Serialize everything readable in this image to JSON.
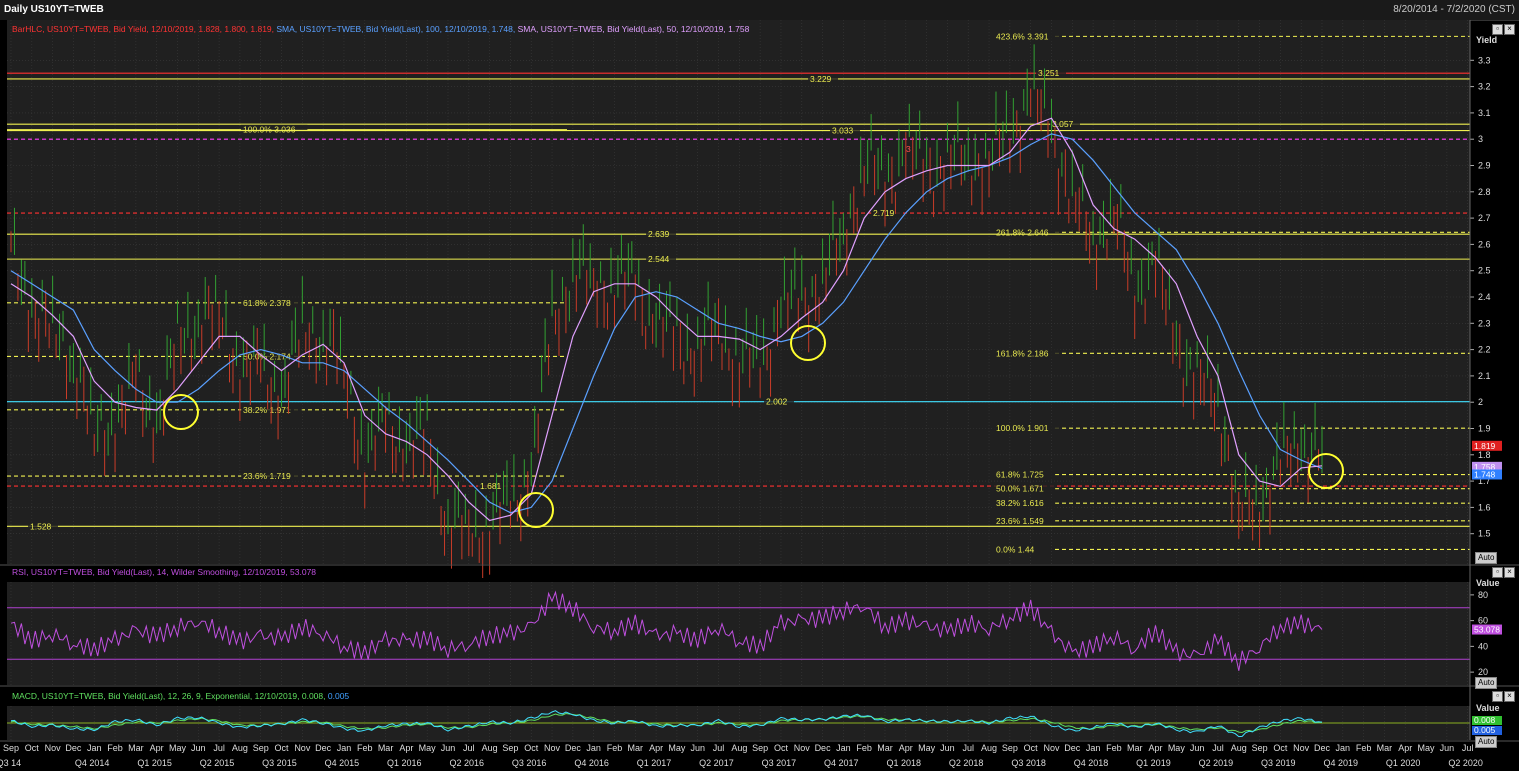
{
  "window": {
    "title": "Daily US10YT=TWEB",
    "range": "8/20/2014 - 7/2/2020 (CST)"
  },
  "panels": {
    "main": {
      "axis_title": "Yield",
      "auto_label": "Auto",
      "legend": [
        {
          "text": "BarHLC, US10YT=TWEB, Bid Yield, 12/10/2019, 1.828, 1.800, 1.819,",
          "color": "#ff3333"
        },
        {
          "text": "SMA, US10YT=TWEB, Bid Yield(Last), 100, 12/10/2019, 1.748,",
          "color": "#5aa0ff"
        },
        {
          "text": "SMA, US10YT=TWEB, Bid Yield(Last), 50, 12/10/2019, 1.758",
          "color": "#e0a0ff"
        }
      ]
    },
    "rsi": {
      "header": "RSI, US10YT=TWEB, Bid Yield(Last), 14, Wilder Smoothing, 12/10/2019, 53.078",
      "axis_title": "Value",
      "auto_label": "Auto",
      "last_label": "53.078"
    },
    "macd": {
      "header_main": "MACD, US10YT=TWEB, Bid Yield(Last), 12, 26, 9, Exponential, 12/10/2019, 0.008,",
      "header_signal": "0.005",
      "axis_title": "Value",
      "auto_label": "Auto",
      "last_macd": "0.008",
      "last_signal": "0.005"
    }
  },
  "colors": {
    "bg": "#000000",
    "plot_bg": "#202020",
    "grid": "#3a3a3a",
    "price": "#c83c28",
    "up": "#32a032",
    "sma100": "#5aa0ff",
    "sma50": "#e0a0ff",
    "yellow": "#f0f050",
    "red_dash": "#ff3030",
    "magenta_dash": "#ff40ff",
    "cyan": "#40e0ff",
    "rsi": "#c050e0",
    "macd": "#40e0ff",
    "signal": "#60e060"
  },
  "chart_data": [
    {
      "type": "line",
      "title": "Daily US10YT=TWEB",
      "ylabel": "Yield",
      "ylim": [
        1.4,
        3.4
      ],
      "y_ticks": [
        "3.3",
        "3.2",
        "3.1",
        "3",
        "2.9",
        "2.8",
        "2.7",
        "2.6",
        "2.5",
        "2.4",
        "2.3",
        "2.2",
        "2.1",
        "2",
        "1.9",
        "1.8",
        "1.7",
        "1.6",
        "1.5"
      ],
      "last_labels": [
        "1.819",
        "1.758",
        "1.748"
      ],
      "x_month_labels": [
        "Sep",
        "Oct",
        "Nov",
        "Dec",
        "Jan",
        "Feb",
        "Mar",
        "Apr",
        "May",
        "Jun",
        "Jul",
        "Aug",
        "Sep",
        "Oct",
        "Nov",
        "Dec",
        "Jan",
        "Feb",
        "Mar",
        "Apr",
        "May",
        "Jun",
        "Jul",
        "Aug",
        "Sep",
        "Oct",
        "Nov",
        "Dec",
        "Jan",
        "Feb",
        "Mar",
        "Apr",
        "May",
        "Jun",
        "Jul",
        "Aug",
        "Sep",
        "Oct",
        "Nov",
        "Dec",
        "Jan",
        "Feb",
        "Mar",
        "Apr",
        "May",
        "Jun",
        "Jul",
        "Aug",
        "Sep",
        "Oct",
        "Nov",
        "Dec",
        "Jan",
        "Feb",
        "Mar",
        "Apr",
        "May",
        "Jun",
        "Jul",
        "Aug",
        "Sep",
        "Oct",
        "Nov",
        "Dec",
        "Jan",
        "Feb",
        "Mar",
        "Apr",
        "May",
        "Jun",
        "Jul"
      ],
      "x_quarter_labels": [
        "Q3 14",
        "Q4 2014",
        "Q1 2015",
        "Q2 2015",
        "Q3 2015",
        "Q4 2015",
        "Q1 2016",
        "Q2 2016",
        "Q3 2016",
        "Q4 2016",
        "Q1 2017",
        "Q2 2017",
        "Q3 2017",
        "Q4 2017",
        "Q1 2018",
        "Q2 2018",
        "Q3 2018",
        "Q4 2018",
        "Q1 2019",
        "Q2 2019",
        "Q3 2019",
        "Q4 2019",
        "Q1 2020",
        "Q2 2020"
      ],
      "series": [
        {
          "name": "BarHLC",
          "kind": "ohlc",
          "dates": [
            "2014-09",
            "2014-10",
            "2014-11",
            "2014-12",
            "2015-01",
            "2015-02",
            "2015-03",
            "2015-04",
            "2015-05",
            "2015-06",
            "2015-07",
            "2015-08",
            "2015-09",
            "2015-10",
            "2015-11",
            "2015-12",
            "2016-01",
            "2016-02",
            "2016-03",
            "2016-04",
            "2016-05",
            "2016-06",
            "2016-07",
            "2016-08",
            "2016-09",
            "2016-10",
            "2016-11",
            "2016-12",
            "2017-01",
            "2017-02",
            "2017-03",
            "2017-04",
            "2017-05",
            "2017-06",
            "2017-07",
            "2017-08",
            "2017-09",
            "2017-10",
            "2017-11",
            "2017-12",
            "2018-01",
            "2018-02",
            "2018-03",
            "2018-04",
            "2018-05",
            "2018-06",
            "2018-07",
            "2018-08",
            "2018-09",
            "2018-10",
            "2018-11",
            "2018-12",
            "2019-01",
            "2019-02",
            "2019-03",
            "2019-04",
            "2019-05",
            "2019-06",
            "2019-07",
            "2019-08",
            "2019-09",
            "2019-10",
            "2019-11",
            "2019-12"
          ],
          "values": [
            2.55,
            2.38,
            2.25,
            2.2,
            1.85,
            1.95,
            2.05,
            1.95,
            2.2,
            2.35,
            2.3,
            2.15,
            2.1,
            2.05,
            2.25,
            2.28,
            2.1,
            1.8,
            1.9,
            1.85,
            1.85,
            1.55,
            1.5,
            1.55,
            1.6,
            1.75,
            2.3,
            2.5,
            2.45,
            2.45,
            2.45,
            2.3,
            2.25,
            2.2,
            2.3,
            2.15,
            2.15,
            2.35,
            2.4,
            2.45,
            2.65,
            2.9,
            2.85,
            2.95,
            2.9,
            2.9,
            2.95,
            2.9,
            3.05,
            3.15,
            3.05,
            2.75,
            2.65,
            2.7,
            2.45,
            2.5,
            2.25,
            2.05,
            2.05,
            1.55,
            1.65,
            1.75,
            1.85,
            1.82
          ]
        },
        {
          "name": "SMA 100",
          "values": [
            2.5,
            2.45,
            2.4,
            2.35,
            2.2,
            2.12,
            2.05,
            2.0,
            2.0,
            2.05,
            2.12,
            2.18,
            2.2,
            2.18,
            2.15,
            2.15,
            2.12,
            2.05,
            1.98,
            1.92,
            1.85,
            1.78,
            1.7,
            1.62,
            1.58,
            1.6,
            1.7,
            1.9,
            2.1,
            2.28,
            2.4,
            2.42,
            2.4,
            2.35,
            2.3,
            2.28,
            2.25,
            2.23,
            2.25,
            2.3,
            2.38,
            2.5,
            2.62,
            2.72,
            2.8,
            2.85,
            2.88,
            2.9,
            2.93,
            2.98,
            3.02,
            3.0,
            2.92,
            2.82,
            2.72,
            2.65,
            2.58,
            2.45,
            2.3,
            2.12,
            1.95,
            1.82,
            1.78,
            1.748
          ]
        },
        {
          "name": "SMA 50",
          "values": [
            2.45,
            2.4,
            2.33,
            2.25,
            2.08,
            2.0,
            1.98,
            1.97,
            2.05,
            2.15,
            2.25,
            2.25,
            2.18,
            2.12,
            2.18,
            2.22,
            2.15,
            1.95,
            1.88,
            1.85,
            1.8,
            1.72,
            1.62,
            1.55,
            1.57,
            1.65,
            1.95,
            2.25,
            2.42,
            2.45,
            2.45,
            2.4,
            2.32,
            2.25,
            2.25,
            2.24,
            2.2,
            2.25,
            2.32,
            2.38,
            2.5,
            2.7,
            2.8,
            2.85,
            2.88,
            2.9,
            2.9,
            2.9,
            2.95,
            3.05,
            3.08,
            2.95,
            2.75,
            2.66,
            2.62,
            2.55,
            2.45,
            2.25,
            2.1,
            1.8,
            1.7,
            1.68,
            1.75,
            1.758
          ]
        }
      ],
      "levels": [
        {
          "label": "423.6%",
          "value": 3.391,
          "text": "3.391"
        },
        {
          "label": "",
          "value": 3.251,
          "text": "3.251"
        },
        {
          "label": "",
          "value": 3.229,
          "text": "3.229"
        },
        {
          "label": "",
          "value": 3.057,
          "text": "3.057"
        },
        {
          "label": "100.0%",
          "value": 3.036,
          "text": "3.036"
        },
        {
          "label": "",
          "value": 3.033,
          "text": "3.033"
        },
        {
          "label": "",
          "value": 3.0,
          "text": ""
        },
        {
          "label": "",
          "value": 2.719,
          "text": "2.719"
        },
        {
          "label": "261.8%",
          "value": 2.646,
          "text": "2.646"
        },
        {
          "label": "",
          "value": 2.639,
          "text": "2.639"
        },
        {
          "label": "",
          "value": 2.544,
          "text": "2.544"
        },
        {
          "label": "61.8%",
          "value": 2.378,
          "text": "2.378"
        },
        {
          "label": "161.8%",
          "value": 2.186,
          "text": "2.186"
        },
        {
          "label": "50.0%",
          "value": 2.174,
          "text": "2.174"
        },
        {
          "label": "",
          "value": 2.002,
          "text": "2.002"
        },
        {
          "label": "38.2%",
          "value": 1.971,
          "text": "1.971"
        },
        {
          "label": "100.0%",
          "value": 1.901,
          "text": "1.901"
        },
        {
          "label": "61.8%",
          "value": 1.725,
          "text": "1.725"
        },
        {
          "label": "23.6%",
          "value": 1.719,
          "text": "1.719"
        },
        {
          "label": "",
          "value": 1.681,
          "text": "1.681"
        },
        {
          "label": "50.0%",
          "value": 1.671,
          "text": "1.671"
        },
        {
          "label": "38.2%",
          "value": 1.616,
          "text": "1.616"
        },
        {
          "label": "23.6%",
          "value": 1.549,
          "text": "1.549"
        },
        {
          "label": "",
          "value": 1.528,
          "text": "1.528"
        },
        {
          "label": "0.0%",
          "value": 1.44,
          "text": "1.44"
        }
      ],
      "annotation_text": [
        "3"
      ]
    },
    {
      "type": "line",
      "title": "RSI",
      "ylabel": "Value",
      "ylim": [
        10,
        90
      ],
      "y_ticks": [
        "80",
        "60",
        "40",
        "20"
      ],
      "bands": [
        70,
        30
      ],
      "series": [
        {
          "name": "RSI",
          "values": [
            58,
            44,
            50,
            42,
            38,
            45,
            52,
            48,
            55,
            60,
            52,
            44,
            48,
            46,
            55,
            50,
            40,
            35,
            45,
            44,
            46,
            38,
            42,
            48,
            50,
            55,
            78,
            70,
            55,
            52,
            58,
            48,
            50,
            45,
            55,
            44,
            40,
            58,
            60,
            62,
            68,
            72,
            55,
            60,
            55,
            52,
            58,
            54,
            62,
            70,
            50,
            35,
            40,
            48,
            38,
            52,
            35,
            32,
            45,
            28,
            40,
            55,
            58,
            53.078
          ]
        }
      ]
    },
    {
      "type": "line",
      "title": "MACD",
      "ylabel": "Value",
      "ylim": [
        -0.15,
        0.15
      ],
      "series": [
        {
          "name": "MACD",
          "values": [
            0.02,
            -0.03,
            -0.02,
            -0.05,
            -0.06,
            0.01,
            0.03,
            -0.02,
            0.04,
            0.05,
            0.0,
            -0.04,
            -0.02,
            -0.01,
            0.03,
            0.0,
            -0.05,
            -0.07,
            -0.02,
            -0.01,
            0.0,
            -0.06,
            -0.03,
            0.01,
            0.0,
            0.04,
            0.1,
            0.08,
            0.02,
            0.0,
            0.02,
            -0.03,
            -0.02,
            -0.02,
            0.02,
            -0.03,
            -0.02,
            0.04,
            0.03,
            0.03,
            0.06,
            0.07,
            0.01,
            0.03,
            0.02,
            0.01,
            0.02,
            0.0,
            0.04,
            0.06,
            -0.02,
            -0.07,
            -0.04,
            0.0,
            -0.04,
            0.0,
            -0.06,
            -0.08,
            -0.02,
            -0.12,
            -0.04,
            0.02,
            0.04,
            0.008
          ]
        },
        {
          "name": "Signal",
          "values": [
            0.01,
            -0.01,
            -0.02,
            -0.03,
            -0.05,
            -0.02,
            0.01,
            0.0,
            0.02,
            0.04,
            0.02,
            -0.02,
            -0.02,
            -0.01,
            0.01,
            0.01,
            -0.03,
            -0.05,
            -0.04,
            -0.02,
            -0.01,
            -0.04,
            -0.04,
            -0.01,
            0.0,
            0.02,
            0.07,
            0.08,
            0.04,
            0.01,
            0.01,
            -0.01,
            -0.02,
            -0.02,
            0.0,
            -0.01,
            -0.02,
            0.02,
            0.03,
            0.03,
            0.05,
            0.06,
            0.03,
            0.03,
            0.02,
            0.01,
            0.02,
            0.01,
            0.02,
            0.04,
            0.01,
            -0.04,
            -0.05,
            -0.02,
            -0.03,
            -0.01,
            -0.04,
            -0.06,
            -0.04,
            -0.08,
            -0.06,
            -0.01,
            0.02,
            0.005
          ]
        }
      ]
    }
  ]
}
